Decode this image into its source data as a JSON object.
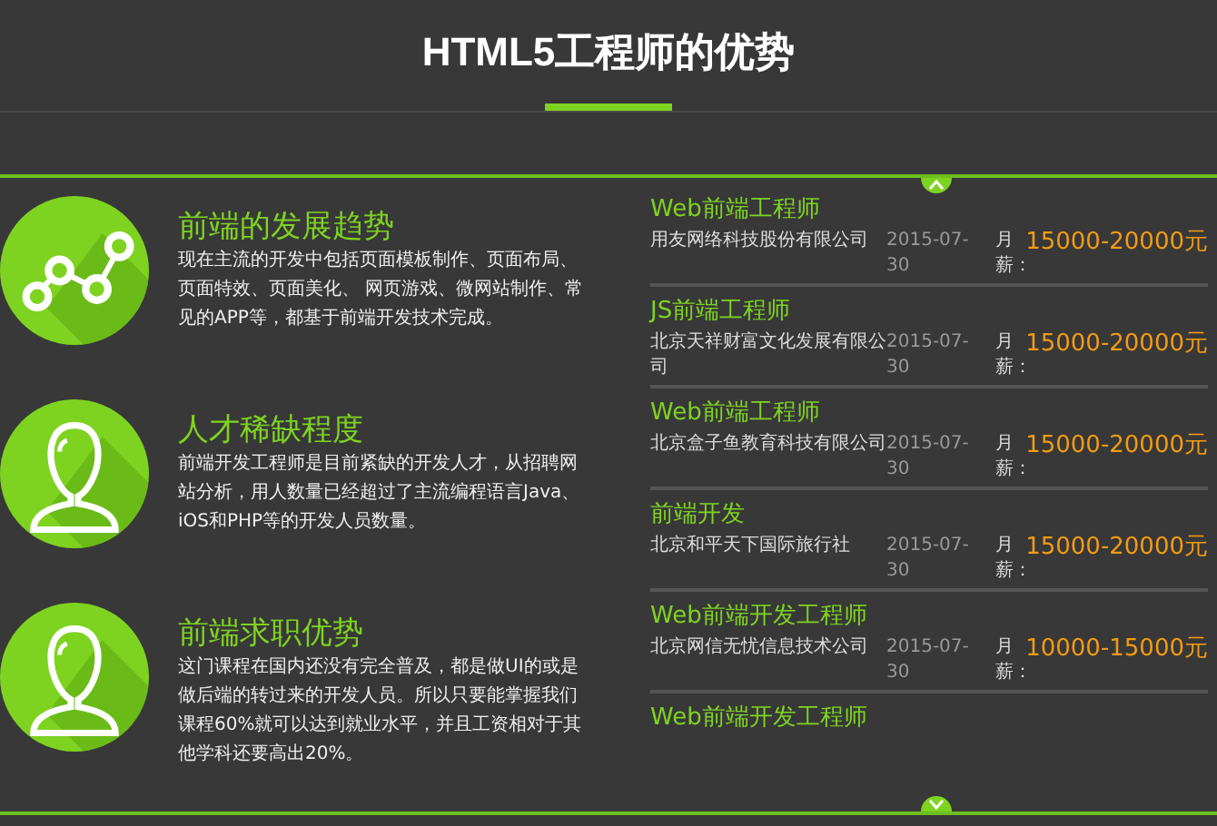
{
  "title": "HTML5工程师的优势",
  "features": [
    {
      "kind": "chart",
      "heading": "前端的发展趋势",
      "text": "现在主流的开发中包括页面模板制作、页面布局、页面特效、页面美化、 网页游戏、微网站制作、常见的APP等，都基于前端开发技术完成。"
    },
    {
      "kind": "person",
      "heading": "人才稀缺程度",
      "text": "前端开发工程师是目前紧缺的开发人才，从招聘网站分析，用人数量已经超过了主流编程语言Java、iOS和PHP等的开发人员数量。"
    },
    {
      "kind": "person",
      "heading": "前端求职优势",
      "text": "这门课程在国内还没有完全普及，都是做UI的或是做后端的转过来的开发人员。所以只要能掌握我们课程60%就可以达到就业水平，并且工资相对于其他学科还要高出20%。"
    }
  ],
  "jobs": [
    {
      "title": "Web前端工程师",
      "company": "用友网络科技股份有限公司",
      "date": "2015-07-30",
      "salary_label": "月薪：",
      "salary": "15000-20000元"
    },
    {
      "title": "JS前端工程师",
      "company": "北京天祥财富文化发展有限公司",
      "date": "2015-07-30",
      "salary_label": "月薪：",
      "salary": "15000-20000元"
    },
    {
      "title": "Web前端工程师",
      "company": "北京盒子鱼教育科技有限公司",
      "date": "2015-07-30",
      "salary_label": "月薪：",
      "salary": "15000-20000元"
    },
    {
      "title": "前端开发",
      "company": "北京和平天下国际旅行社",
      "date": "2015-07-30",
      "salary_label": "月薪：",
      "salary": "15000-20000元"
    },
    {
      "title": "Web前端开发工程师",
      "company": "北京网信无忧信息技术公司",
      "date": "2015-07-30",
      "salary_label": "月薪：",
      "salary": "10000-15000元"
    },
    {
      "title": "Web前端开发工程师"
    }
  ]
}
